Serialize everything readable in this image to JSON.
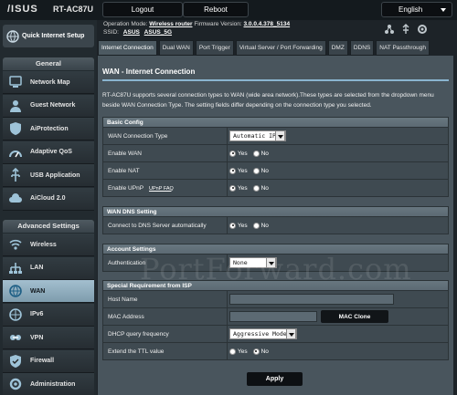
{
  "brand": {
    "logo": "/ISUS",
    "model": "RT-AC87U"
  },
  "topbar": {
    "logout": "Logout",
    "reboot": "Reboot",
    "language": "English"
  },
  "status": {
    "op_mode_label": "Operation Mode:",
    "op_mode_value": "Wireless router",
    "fw_label": "Firmware Version:",
    "fw_value": "3.0.0.4.378_5134",
    "ssid_label": "SSID:",
    "ssid_1": "ASUS",
    "ssid_2": "ASUS_5G"
  },
  "sidebar": {
    "qis": "Quick Internet Setup",
    "general_header": "General",
    "general": [
      {
        "label": "Network Map",
        "icon": "network-map-icon"
      },
      {
        "label": "Guest Network",
        "icon": "guest-network-icon"
      },
      {
        "label": "AiProtection",
        "icon": "aiprotection-icon"
      },
      {
        "label": "Adaptive QoS",
        "icon": "qos-icon"
      },
      {
        "label": "USB Application",
        "icon": "usb-icon"
      },
      {
        "label": "AiCloud 2.0",
        "icon": "aicloud-icon"
      }
    ],
    "advanced_header": "Advanced Settings",
    "advanced": [
      {
        "label": "Wireless",
        "icon": "wireless-icon"
      },
      {
        "label": "LAN",
        "icon": "lan-icon"
      },
      {
        "label": "WAN",
        "icon": "wan-icon",
        "active": true
      },
      {
        "label": "IPv6",
        "icon": "ipv6-icon"
      },
      {
        "label": "VPN",
        "icon": "vpn-icon"
      },
      {
        "label": "Firewall",
        "icon": "firewall-icon"
      },
      {
        "label": "Administration",
        "icon": "administration-icon"
      }
    ]
  },
  "tabs": [
    "Internet Connection",
    "Dual WAN",
    "Port Trigger",
    "Virtual Server / Port Forwarding",
    "DMZ",
    "DDNS",
    "NAT Passthrough"
  ],
  "main": {
    "title": "WAN - Internet Connection",
    "description": "RT-AC87U supports several connection types to WAN (wide area network).These types are selected from the dropdown menu beside WAN Connection Type. The setting fields differ depending on the connection type you selected.",
    "basic": {
      "header": "Basic Config",
      "wan_type_label": "WAN Connection Type",
      "wan_type_value": "Automatic IP",
      "enable_wan_label": "Enable WAN",
      "enable_nat_label": "Enable NAT",
      "upnp_label": "Enable UPnP",
      "upnp_faq": "UPnP  FAQ"
    },
    "dns": {
      "header": "WAN DNS Setting",
      "auto_label": "Connect to DNS Server automatically"
    },
    "account": {
      "header": "Account Settings",
      "auth_label": "Authentication",
      "auth_value": "None"
    },
    "isp": {
      "header": "Special Requirement from ISP",
      "host_label": "Host Name",
      "host_value": "",
      "mac_label": "MAC Address",
      "mac_value": "",
      "mac_clone": "MAC Clone",
      "dhcp_label": "DHCP query frequency",
      "dhcp_value": "Aggressive Mode",
      "ttl_label": "Extend the TTL value"
    },
    "yes": "Yes",
    "no": "No",
    "apply": "Apply"
  },
  "watermark": "PortForward.com"
}
